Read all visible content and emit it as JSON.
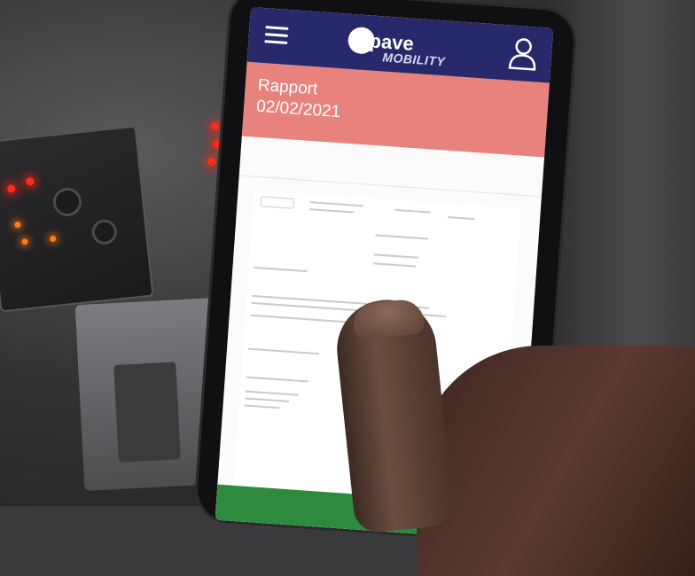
{
  "app": {
    "brand_word": "pave",
    "brand_sub": "MOBILITY",
    "report_title": "Rapport",
    "report_date": "02/02/2021"
  },
  "colors": {
    "header": "#27296b",
    "banner": "#e8827c",
    "bottom_bar": "#2e8b3e"
  },
  "icons": [
    "menu-icon",
    "user-icon"
  ]
}
